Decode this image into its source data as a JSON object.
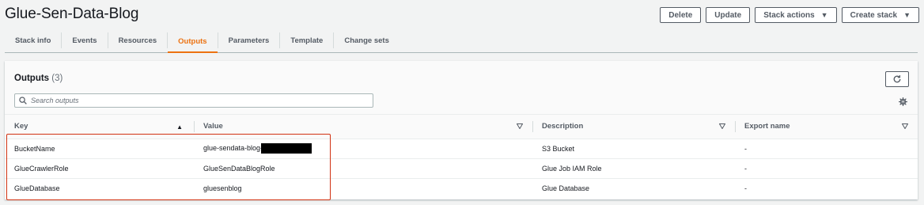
{
  "stack": {
    "title": "Glue-Sen-Data-Blog"
  },
  "actions": {
    "delete": "Delete",
    "update": "Update",
    "stack_actions": "Stack actions",
    "create_stack": "Create stack"
  },
  "tabs": [
    {
      "label": "Stack info"
    },
    {
      "label": "Events"
    },
    {
      "label": "Resources"
    },
    {
      "label": "Outputs",
      "active": true
    },
    {
      "label": "Parameters"
    },
    {
      "label": "Template"
    },
    {
      "label": "Change sets"
    }
  ],
  "outputs": {
    "title": "Outputs",
    "count": "(3)",
    "search_placeholder": "Search outputs",
    "columns": {
      "key": "Key",
      "value": "Value",
      "description": "Description",
      "export": "Export name"
    },
    "rows": [
      {
        "key": "BucketName",
        "value": "glue-sendata-blog-",
        "value_redacted": true,
        "description": "S3 Bucket",
        "export": "-"
      },
      {
        "key": "GlueCrawlerRole",
        "value": "GlueSenDataBlogRole",
        "description": "Glue Job IAM Role",
        "export": "-"
      },
      {
        "key": "GlueDatabase",
        "value": "gluesenblog",
        "description": "Glue Database",
        "export": "-"
      }
    ]
  },
  "colors": {
    "accent": "#ec7211",
    "highlight": "#d13212"
  }
}
